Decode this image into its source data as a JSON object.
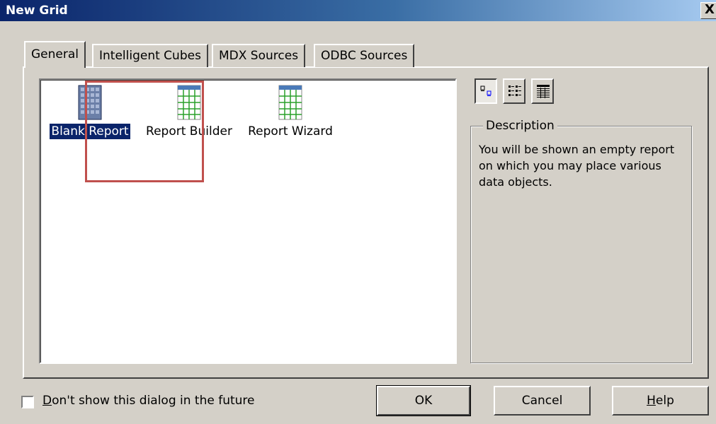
{
  "window": {
    "title": "New Grid",
    "close_glyph": "X"
  },
  "tabs": [
    {
      "label": "General",
      "active": true
    },
    {
      "label": "Intelligent Cubes",
      "active": false
    },
    {
      "label": "MDX Sources",
      "active": false
    },
    {
      "label": "ODBC Sources",
      "active": false
    }
  ],
  "items": [
    {
      "label": "Blank Report",
      "icon": "blank-grid-icon",
      "selected": true
    },
    {
      "label": "Report Builder",
      "icon": "grid-icon",
      "selected": false
    },
    {
      "label": "Report Wizard",
      "icon": "grid-icon",
      "selected": false
    }
  ],
  "view_buttons": [
    {
      "icon": "large-icons-view-icon",
      "pressed": true
    },
    {
      "icon": "list-view-icon",
      "pressed": false
    },
    {
      "icon": "details-view-icon",
      "pressed": false
    }
  ],
  "description": {
    "legend": "Description",
    "text": "You will be shown an empty report on which you may place various data objects."
  },
  "footer": {
    "checkbox_label_rest": "on't show this dialog in the future",
    "checkbox_accel": "D",
    "checked": false,
    "ok_label": "OK",
    "cancel_label": "Cancel",
    "help_accel": "H",
    "help_label_rest": "elp"
  },
  "colors": {
    "highlight": "#c0504d",
    "selection": "#0a246a"
  }
}
